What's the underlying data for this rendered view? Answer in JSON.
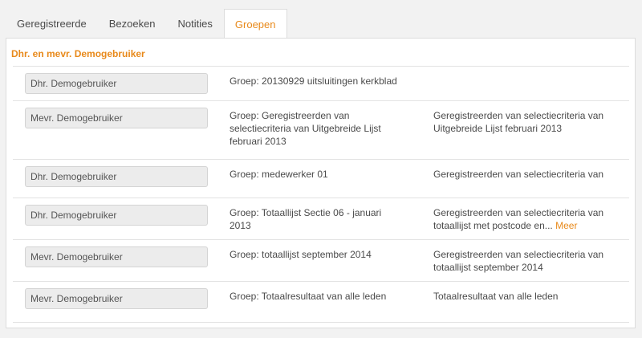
{
  "tabs": [
    {
      "label": "Geregistreerde",
      "active": false
    },
    {
      "label": "Bezoeken",
      "active": false
    },
    {
      "label": "Notities",
      "active": false
    },
    {
      "label": "Groepen",
      "active": true
    }
  ],
  "colors": {
    "accent": "#e8891a"
  },
  "person_heading": "Dhr. en mevr. Demogebruiker",
  "rows": [
    {
      "name": "Dhr. Demogebruiker",
      "group": "Groep: 20130929 uitsluitingen kerkblad",
      "description": "",
      "more": ""
    },
    {
      "name": "Mevr. Demogebruiker",
      "group": "Groep: Geregistreerden van selectiecriteria van Uitgebreide Lijst februari 2013",
      "description": "Geregistreerden van selectiecriteria van Uitgebreide Lijst februari 2013",
      "more": ""
    },
    {
      "name": "Dhr. Demogebruiker",
      "group": "Groep: medewerker 01",
      "description": "Geregistreerden van selectiecriteria van",
      "more": ""
    },
    {
      "name": "Dhr. Demogebruiker",
      "group": "Groep: Totaallijst Sectie 06 - januari 2013",
      "description": "Geregistreerden van selectiecriteria van totaallijst met postcode en...",
      "more": "Meer"
    },
    {
      "name": "Mevr. Demogebruiker",
      "group": "Groep: totaallijst september 2014",
      "description": "Geregistreerden van selectiecriteria van totaallijst september 2014",
      "more": ""
    },
    {
      "name": "Mevr. Demogebruiker",
      "group": "Groep: Totaalresultaat van alle leden",
      "description": "Totaalresultaat van alle leden",
      "more": ""
    }
  ]
}
